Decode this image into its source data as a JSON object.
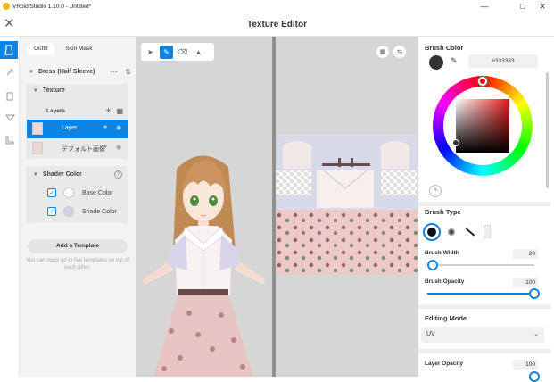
{
  "window": {
    "title": "VRoid Studio 1.10.0 - Untitled*"
  },
  "header": {
    "title": "Texture Editor",
    "close_glyph": "✕"
  },
  "left": {
    "tabs": [
      "Outfit",
      "Skin Mask"
    ],
    "item_title": "Dress (Half Sleeve)",
    "texture_label": "Texture",
    "layers_label": "Layers",
    "layers": [
      "Layer",
      "デフォルト画像"
    ],
    "shader_label": "Shader Color",
    "base_color_label": "Base Color",
    "shade_color_label": "Shade Color",
    "add_template": "Add a Template",
    "template_hint": "You can stack up to five templates on top of each other."
  },
  "colors": {
    "accent": "#0d84e3",
    "brush": "#333333",
    "shade": "#cfd0f0",
    "base": "#ffffff"
  },
  "right": {
    "brush_color_title": "Brush Color",
    "hex_value": "#333333",
    "brush_type_title": "Brush Type",
    "brush_width_label": "Brush Width",
    "brush_width_value": "20",
    "brush_opacity_label": "Brush Opacity",
    "brush_opacity_value": "100",
    "editing_mode_title": "Editing Mode",
    "editing_mode_value": "UV",
    "layer_opacity_label": "Layer Opacity",
    "layer_opacity_value": "100"
  },
  "sliders": {
    "brush_width": 0.05,
    "brush_opacity": 1.0
  }
}
